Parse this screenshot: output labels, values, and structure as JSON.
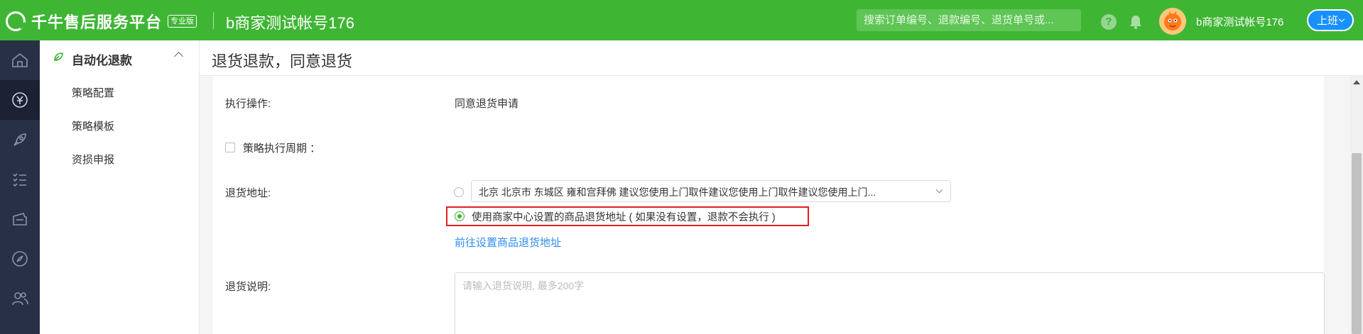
{
  "brand": {
    "name": "千牛售后服务平台",
    "badge": "专业版"
  },
  "header": {
    "account_title": "b商家测试帐号176",
    "search_placeholder": "搜索订单编号、退款编号、退货单号或...",
    "help_label": "?",
    "user_name": "b商家测试帐号176",
    "status_button": "上班",
    "accent_color": "#3fb534"
  },
  "rail": {
    "icons": [
      "home-icon",
      "yuan-icon",
      "rocket-icon",
      "list-icon",
      "ticket-icon",
      "compass-icon",
      "users-icon"
    ]
  },
  "subnav": {
    "title": "自动化退款",
    "items": [
      {
        "label": "策略配置"
      },
      {
        "label": "策略模板"
      },
      {
        "label": "资损申报"
      }
    ]
  },
  "page": {
    "title": "退货退款，同意退货"
  },
  "form": {
    "action_label": "执行操作:",
    "action_value": "同意退货申请",
    "period_label": "策略执行周期 ：",
    "address_label": "退货地址:",
    "address_select_value": "北京 北京市 东城区 雍和宫拜佛 建议您使用上门取件建议您使用上门取件建议您使用上门...",
    "use_center_address": "使用商家中心设置的商品退货地址 ( 如果没有设置，退款不会执行 )",
    "goto_link": "前往设置商品退货地址",
    "desc_label": "退货说明:",
    "desc_placeholder": "请输入退货说明, 最多200字"
  }
}
